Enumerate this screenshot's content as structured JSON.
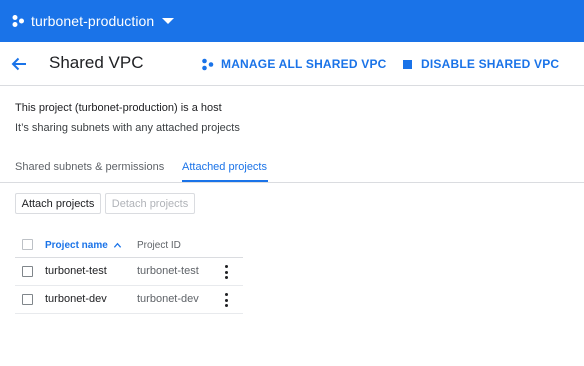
{
  "topbar": {
    "project_name": "turbonet-production",
    "project_icon": "project-nodes-icon",
    "dropdown_icon": "caret-down-icon",
    "color": "#1a73e8"
  },
  "header": {
    "back_icon": "arrow-back-icon",
    "title": "Shared VPC",
    "manage_label": "MANAGE ALL SHARED VPC",
    "disable_label": "DISABLE SHARED VPC"
  },
  "host": {
    "title": "This project (turbonet-production) is a host",
    "subtitle": "It’s sharing subnets with any attached projects"
  },
  "tabs": [
    {
      "label": "Shared subnets & permissions",
      "active": false
    },
    {
      "label": "Attached projects",
      "active": true
    }
  ],
  "actions": {
    "attach_label": "Attach projects",
    "detach_label": "Detach projects"
  },
  "table": {
    "columns": [
      "Project name",
      "Project ID"
    ],
    "sort": "ascending",
    "rows": [
      {
        "name": "turbonet-test",
        "id": "turbonet-test"
      },
      {
        "name": "turbonet-dev",
        "id": "turbonet-dev"
      }
    ]
  }
}
